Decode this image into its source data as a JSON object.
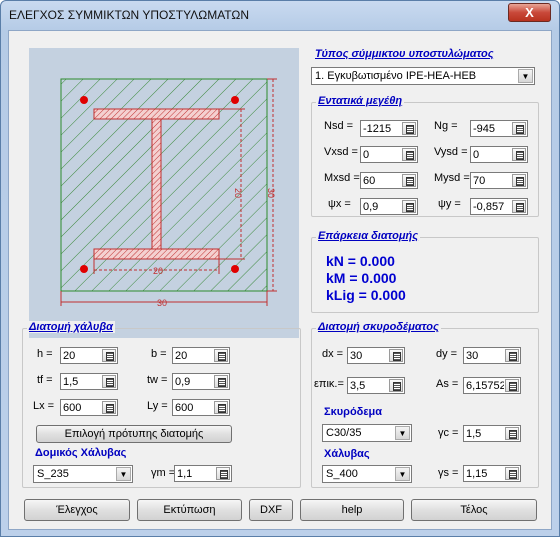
{
  "window": {
    "title": "ΕΛΕΓΧΟΣ ΣΥΜΜΙΚΤΩΝ ΥΠΟΣΤΥΛΩΜΑΤΩΝ",
    "close_glyph": "X"
  },
  "drawing": {
    "dim_inner_h": "20",
    "dim_outer_h": "30",
    "dim_inner_w": "20",
    "dim_outer_w": "30"
  },
  "type_section": {
    "title": "Τύπος σύμμικτου υποστυλώματος",
    "selected": "1. Εγκυβωτισμένο IPE-HEA-HEB"
  },
  "forces": {
    "title": "Εντατικά μεγέθη",
    "nsd": {
      "label": "Nsd =",
      "value": "-1215"
    },
    "ng": {
      "label": "Ng =",
      "value": "-945"
    },
    "vxsd": {
      "label": "Vxsd =",
      "value": "0"
    },
    "vysd": {
      "label": "Vysd =",
      "value": "0"
    },
    "mxsd": {
      "label": "Mxsd =",
      "value": "60"
    },
    "mysd": {
      "label": "Mysd =",
      "value": "70"
    },
    "psix": {
      "label": "ψx =",
      "value": "0,9"
    },
    "psiy": {
      "label": "ψy =",
      "value": "-0,857"
    }
  },
  "adequacy": {
    "title": "Επάρκεια διατομής",
    "kN": "kN = 0.000",
    "kM": "kM = 0.000",
    "kLig": "kLig = 0.000"
  },
  "steel": {
    "title": "Διατομή χάλυβα",
    "h": {
      "label": "h =",
      "value": "20"
    },
    "b": {
      "label": "b =",
      "value": "20"
    },
    "tf": {
      "label": "tf =",
      "value": "1,5"
    },
    "tw": {
      "label": "tw =",
      "value": "0,9"
    },
    "lx": {
      "label": "Lx =",
      "value": "600"
    },
    "ly": {
      "label": "Ly =",
      "value": "600"
    },
    "pick_button": "Επιλογή πρότυπης διατομής",
    "material_title": "Δομικός Χάλυβας",
    "material": "S_235",
    "gm": {
      "label": "γm =",
      "value": "1,1"
    }
  },
  "concrete": {
    "title": "Διατομή σκυροδέματος",
    "dx": {
      "label": "dx =",
      "value": "30"
    },
    "dy": {
      "label": "dy =",
      "value": "30"
    },
    "cover": {
      "label": "επικ.=",
      "value": "3,5"
    },
    "as": {
      "label": "As =",
      "value": "6,15752"
    },
    "concrete_title": "Σκυρόδεμα",
    "concrete_class": "C30/35",
    "gc": {
      "label": "γc =",
      "value": "1,5"
    },
    "rebar_title": "Χάλυβας",
    "rebar": "S_400",
    "gs": {
      "label": "γs =",
      "value": "1,15"
    }
  },
  "buttons": {
    "check": "Έλεγχος",
    "print": "Εκτύπωση",
    "dxf": "DXF",
    "help": "help",
    "end": "Τέλος"
  }
}
